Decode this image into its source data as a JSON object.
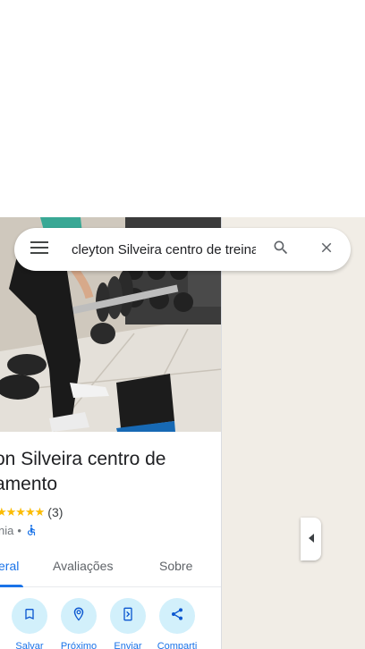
{
  "search": {
    "value": "cleyton Silveira centro de treinamento",
    "menu_icon": "hamburger-menu-icon",
    "search_icon": "magnifier-icon",
    "close_icon": "close-x-icon"
  },
  "place": {
    "title": "on Silveira centro de\ntreinamento",
    "title_visible": "on Silveira centro de amento",
    "rating_stars": "★★★★★",
    "rating_count": "(3)",
    "category": "nia",
    "separator": "•",
    "accessibility_icon": "wheelchair-icon"
  },
  "tabs": [
    {
      "label": "eral",
      "active": true
    },
    {
      "label": "Avaliações",
      "active": false
    },
    {
      "label": "Sobre",
      "active": false
    }
  ],
  "actions": [
    {
      "label": "Salvar",
      "icon": "bookmark-icon"
    },
    {
      "label": "Próximo",
      "icon": "nearby-pin-icon"
    },
    {
      "label": "Enviar",
      "icon": "send-to-phone-icon"
    },
    {
      "label": "Comparti",
      "icon": "share-icon"
    }
  ],
  "colors": {
    "accent": "#1a73e8",
    "star": "#fbbc04",
    "action_circle": "#d2f0fb",
    "map_bg": "#f1ede6"
  }
}
